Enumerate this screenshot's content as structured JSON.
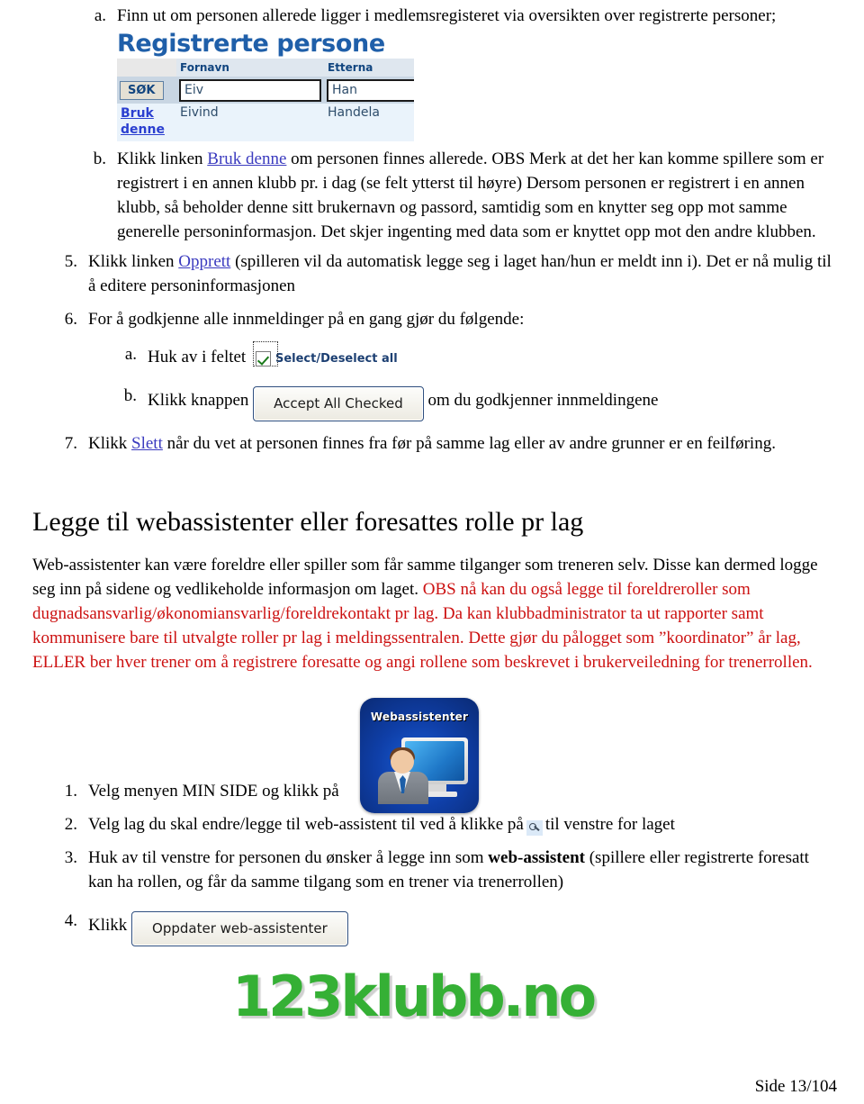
{
  "top_list": {
    "item_a": {
      "marker": "a.",
      "text": "Finn ut om personen allerede ligger i medlemsregisteret via oversikten over registrerte personer;"
    },
    "item_b": {
      "marker": "b.",
      "text_before_link": "Klikk linken ",
      "link": "Bruk denne",
      "text_after_link": " om personen finnes allerede. OBS Merk at det her kan komme spillere som er registrert i en annen klubb pr. i dag (se felt ytterst til høyre) Dersom personen er registrert i en annen klubb, så beholder denne sitt brukernavn og passord, samtidig som en knytter seg opp mot samme generelle personinformasjon. Det skjer ingenting med data som er knyttet opp mot den andre klubben."
    }
  },
  "screenshot_registrerte": {
    "title": "Registrerte persone",
    "columns": [
      "",
      "Fornavn",
      "Etterna"
    ],
    "search_button": "SØK",
    "search_values": [
      "Eiv",
      "Han"
    ],
    "row": {
      "link_line1": "Bruk",
      "link_line2": "denne",
      "fornavn": "Eivind",
      "etternavn": "Handela"
    }
  },
  "numbered_list": {
    "item5": {
      "marker": "5.",
      "before_link": "Klikk linken ",
      "link": "Opprett",
      "after_link": " (spilleren vil da automatisk legge seg i laget han/hun er meldt inn i). Det er nå mulig til å editere personinformasjonen"
    },
    "item6": {
      "marker": "6.",
      "text": "For å godkjenne alle innmeldinger på en gang gjør du følgende:",
      "sub_a": {
        "marker": "a.",
        "text": "Huk av i feltet",
        "checkbox_label": "Select/Deselect all"
      },
      "sub_b": {
        "marker": "b.",
        "text_before": "Klikk knappen",
        "button_label": "Accept All Checked",
        "text_after": "om du godkjenner innmeldingene"
      }
    },
    "item7": {
      "marker": "7.",
      "before_link": "Klikk ",
      "link": "Slett",
      "after_link": " når du vet at personen finnes fra før på samme lag eller av andre grunner er en feilføring."
    }
  },
  "section": {
    "title": "Legge til webassistenter eller foresattes rolle pr lag",
    "paragraph_black": "Web-assistenter kan være foreldre eller spiller som får samme tilganger som treneren selv. Disse kan dermed logge seg inn på sidene og vedlikeholde informasjon om laget. ",
    "paragraph_red": "OBS nå kan du også legge til foreldreroller som dugnadsansvarlig/økonomiansvarlig/foreldrekontakt pr lag. Da kan klubbadministrator ta ut rapporter samt kommunisere bare til utvalgte roller pr lag i meldingssentralen. Dette gjør du pålogget som ”koordinator” år lag, ELLER ber hver trener om å registrere foresatte og angi rollene som beskrevet i brukerveiledning for trenerrollen."
  },
  "webassistenter_icon": {
    "label": "Webassistenter"
  },
  "bottom_list": {
    "item1": {
      "marker": "1.",
      "text": "Velg menyen MIN SIDE og klikk på"
    },
    "item2": {
      "marker": "2.",
      "text_before": "Velg lag du skal endre/legge til web-assistent til ved å klikke på",
      "text_after": "til venstre for laget"
    },
    "item3": {
      "marker": "3.",
      "text_before_bold": "Huk av til venstre for personen du ønsker å legge inn som ",
      "bold": "web-assistent",
      "text_after_bold": " (spillere eller registrerte foresatt kan ha rollen, og får da samme tilgang som en trener via trenerrollen)"
    },
    "item4": {
      "marker": "4.",
      "text": "Klikk",
      "button_label": "Oppdater web-assistenter"
    }
  },
  "footer": {
    "logo": "123klubb.no",
    "page_number": "Side 13/104"
  },
  "colors": {
    "link": "#3b3bbf",
    "red_text": "#cc1111",
    "shot_title_blue": "#1f5fa9",
    "logo_green": "#35b035",
    "button_border": "#2f4f7f"
  }
}
